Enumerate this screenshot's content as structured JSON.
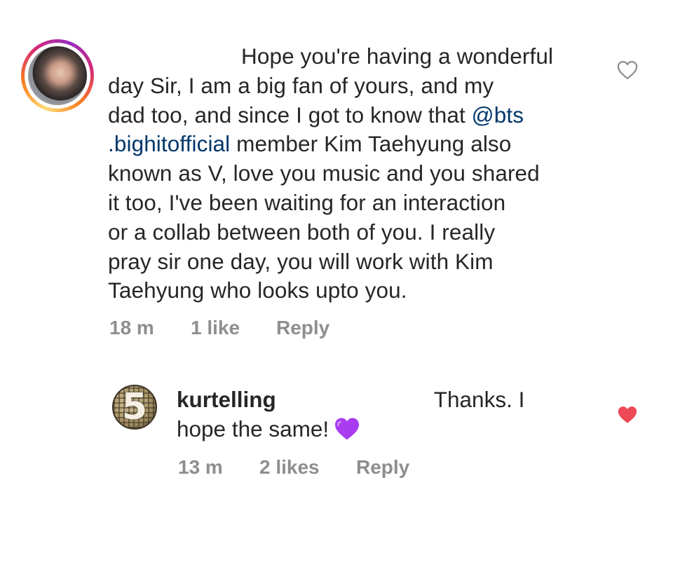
{
  "comment": {
    "text_line1": "Hope you're having a wonderful",
    "text_line2": "day Sir, I am a big fan of yours, and my",
    "text_line3_a": "dad too, and since I got to know that ",
    "mention_a": "@bts",
    "mention_b": ".bighitofficial",
    "text_line4_b": " member Kim Taehyung also",
    "text_line5": "known as V, love you music and you shared",
    "text_line6": "it too, I've been waiting for an interaction",
    "text_line7": "or a collab between both of you. I really",
    "text_line8": "pray sir one day, you will work with Kim",
    "text_line9": "Taehyung who looks upto you.",
    "time": "18 m",
    "likes": "1 like",
    "reply_label": "Reply",
    "heart_icon": "heart-outline-icon",
    "heart_color": "#8e8e8e"
  },
  "reply": {
    "username": "kurtelling",
    "text_part1": "Thanks. I",
    "text_part2": "hope the same!",
    "emoji": "purple-heart-icon",
    "time": "13 m",
    "likes": "2 likes",
    "reply_label": "Reply",
    "heart_icon": "heart-filled-icon",
    "heart_color": "#ed4956",
    "emoji_color": "#a93cf0"
  },
  "colors": {
    "text": "#262626",
    "meta": "#8e8e8e",
    "mention": "#00376b",
    "like_red": "#ed4956"
  }
}
